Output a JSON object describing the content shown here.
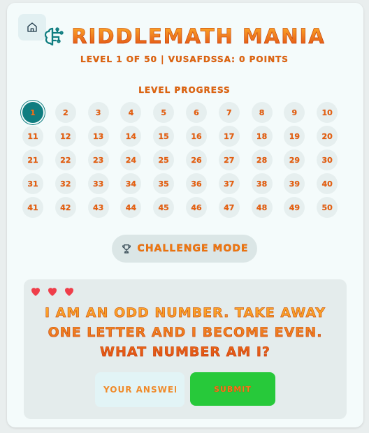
{
  "header": {
    "title": "RiddleMath Mania",
    "subtitle": "Level 1 of 50 | vusafdssa: 0 points",
    "home_icon": "home-icon",
    "brand_icon": "brain-icon"
  },
  "progress": {
    "label": "Level Progress",
    "current_level": 1,
    "levels": [
      "1",
      "2",
      "3",
      "4",
      "5",
      "6",
      "7",
      "8",
      "9",
      "10",
      "11",
      "12",
      "13",
      "14",
      "15",
      "16",
      "17",
      "18",
      "19",
      "20",
      "21",
      "22",
      "23",
      "24",
      "25",
      "26",
      "27",
      "28",
      "29",
      "30",
      "31",
      "32",
      "33",
      "34",
      "35",
      "36",
      "37",
      "38",
      "39",
      "40",
      "41",
      "42",
      "43",
      "44",
      "45",
      "46",
      "47",
      "48",
      "49",
      "50"
    ]
  },
  "challenge": {
    "label": "Challenge Mode",
    "icon": "trophy-icon"
  },
  "game": {
    "lives": 3,
    "riddle": "I am an odd number. Take away one letter and I become even. What number am I?",
    "answer_placeholder": "Your answer",
    "answer_value": "",
    "submit_label": "Submit"
  },
  "colors": {
    "accent": "#f07a0c",
    "active_level": "#0f7d80",
    "submit": "#27c93a",
    "heart": "#ef3e4a"
  }
}
